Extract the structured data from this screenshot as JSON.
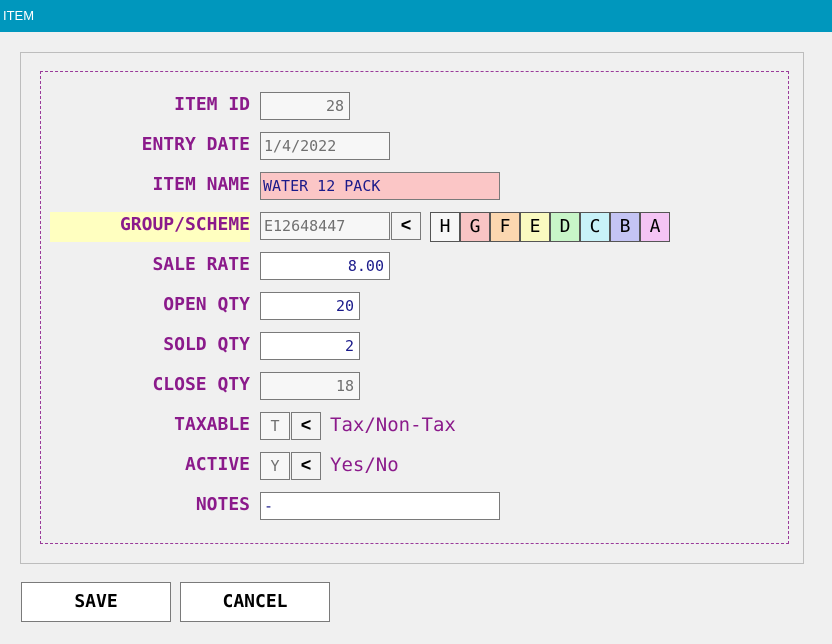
{
  "window": {
    "title": "ITEM"
  },
  "form": {
    "item_id": {
      "label": "ITEM ID",
      "value": "28"
    },
    "entry_date": {
      "label": "ENTRY DATE",
      "value": "1/4/2022"
    },
    "item_name": {
      "label": "ITEM NAME",
      "value": "WATER 12 PACK"
    },
    "group_scheme": {
      "label": "GROUP/SCHEME",
      "value": "E12648447",
      "picker_label": "<",
      "options": [
        {
          "letter": "H",
          "color": "#f7f7f7"
        },
        {
          "letter": "G",
          "color": "#f8c4c4"
        },
        {
          "letter": "F",
          "color": "#fbd7b0"
        },
        {
          "letter": "E",
          "color": "#fafac0"
        },
        {
          "letter": "D",
          "color": "#c8f5c8"
        },
        {
          "letter": "C",
          "color": "#c8f2f8"
        },
        {
          "letter": "B",
          "color": "#c4c4f4"
        },
        {
          "letter": "A",
          "color": "#f4c4f4"
        }
      ]
    },
    "sale_rate": {
      "label": "SALE RATE",
      "value": "8.00"
    },
    "open_qty": {
      "label": "OPEN QTY",
      "value": "20"
    },
    "sold_qty": {
      "label": "SOLD QTY",
      "value": "2"
    },
    "close_qty": {
      "label": "CLOSE QTY",
      "value": "18"
    },
    "taxable": {
      "label": "TAXABLE",
      "value": "T",
      "toggle_label": "<",
      "hint": "Tax/Non-Tax"
    },
    "active": {
      "label": "ACTIVE",
      "value": "Y",
      "toggle_label": "<",
      "hint": "Yes/No"
    },
    "notes": {
      "label": "NOTES",
      "value": "-"
    }
  },
  "actions": {
    "save_label": "SAVE",
    "cancel_label": "CANCEL"
  }
}
